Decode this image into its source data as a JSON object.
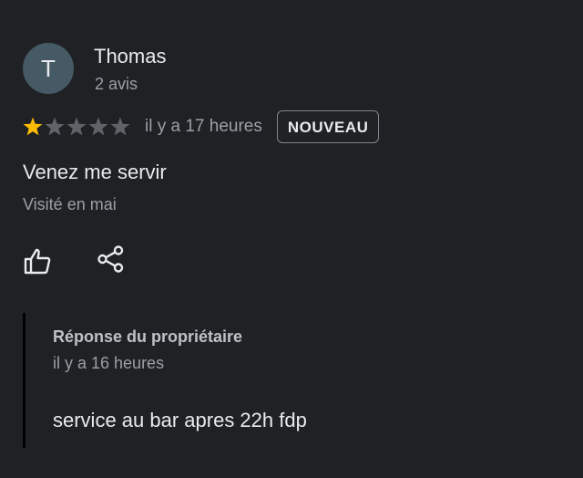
{
  "review": {
    "author": {
      "initial": "T",
      "name": "Thomas",
      "meta": "2 avis"
    },
    "rating": {
      "value": 1,
      "max": 5,
      "filled_color": "#fbbc04",
      "empty_color": "#5f6368"
    },
    "time": "il y a 17 heures",
    "badge": "NOUVEAU",
    "text": "Venez me servir",
    "visit": "Visité en mai",
    "actions": {
      "like_icon": "thumbs-up-icon",
      "share_icon": "share-icon"
    }
  },
  "owner_reply": {
    "title": "Réponse du propriétaire",
    "time": "il y a 16 heures",
    "text": "service au bar apres 22h fdp"
  }
}
